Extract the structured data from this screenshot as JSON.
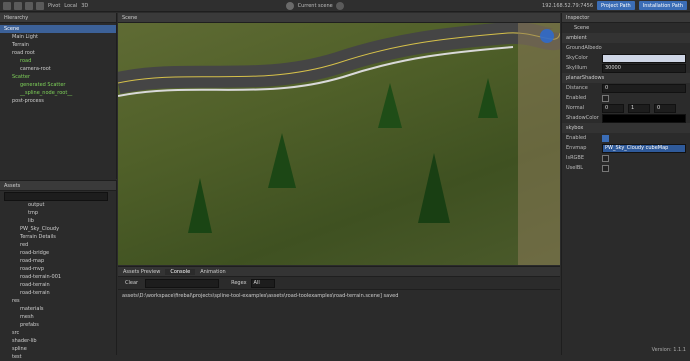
{
  "topbar": {
    "pivot": "Pivot",
    "local": "Local",
    "mode3d": "3D",
    "scene_select": "Current scene",
    "ip": "192.168.52.79:7456",
    "project_path_btn": "Project Path",
    "install_path_btn": "Installation Path"
  },
  "hierarchy": {
    "title": "Hierarchy",
    "items": [
      "Scene",
      "Main Light",
      "Terrain",
      "road root",
      "road",
      "camera-root",
      "Scatter",
      "generated Scatter",
      "__spline_node_root__",
      "post-process"
    ]
  },
  "assets": {
    "title": "Assets",
    "items": [
      "output",
      "tmp",
      "lib",
      "PW_Sky_Cloudy",
      "Terrain Details",
      "red",
      "road-bridge",
      "road-map",
      "road-mvp",
      "road-terrain-001",
      "road-terrain",
      "road-terrain",
      "res",
      "materials",
      "mesh",
      "prefabs",
      "src",
      "shader-lib",
      "spline",
      "test"
    ]
  },
  "scene": {
    "title": "Scene"
  },
  "console": {
    "tabs": [
      "Assets Preview",
      "Console",
      "Animation"
    ],
    "clear": "Clear",
    "regex": "Regex",
    "filter": "All",
    "log": "assets\\D:\\workspace\\firebal\\projects\\spline-tool-examples\\assets\\road-toolexamples\\road-terrain.scene] saved"
  },
  "inspector": {
    "title": "Inspector",
    "breadcrumb": "Scene",
    "ambient": "ambient",
    "ground_albedo": "GroundAlbedo",
    "sky_color": "SkyColor",
    "sky_illum": "SkyIllum",
    "sky_illum_value": "30000",
    "planar_shadows": "planarShadows",
    "distance": "Distance",
    "distance_value": "0",
    "enabled": "Enabled",
    "normal": "Normal",
    "nx": "0",
    "ny": "1",
    "nz": "0",
    "shadow_color": "ShadowColor",
    "skybox": "skybox",
    "skybox_enabled": "Enabled",
    "envmap": "Envmap",
    "envmap_value": "PW_Sky_Cloudy cubeMap",
    "is_rgbe": "IsRGBE",
    "use_ibl": "UseIBL",
    "version": "Version: 1.1.1"
  }
}
